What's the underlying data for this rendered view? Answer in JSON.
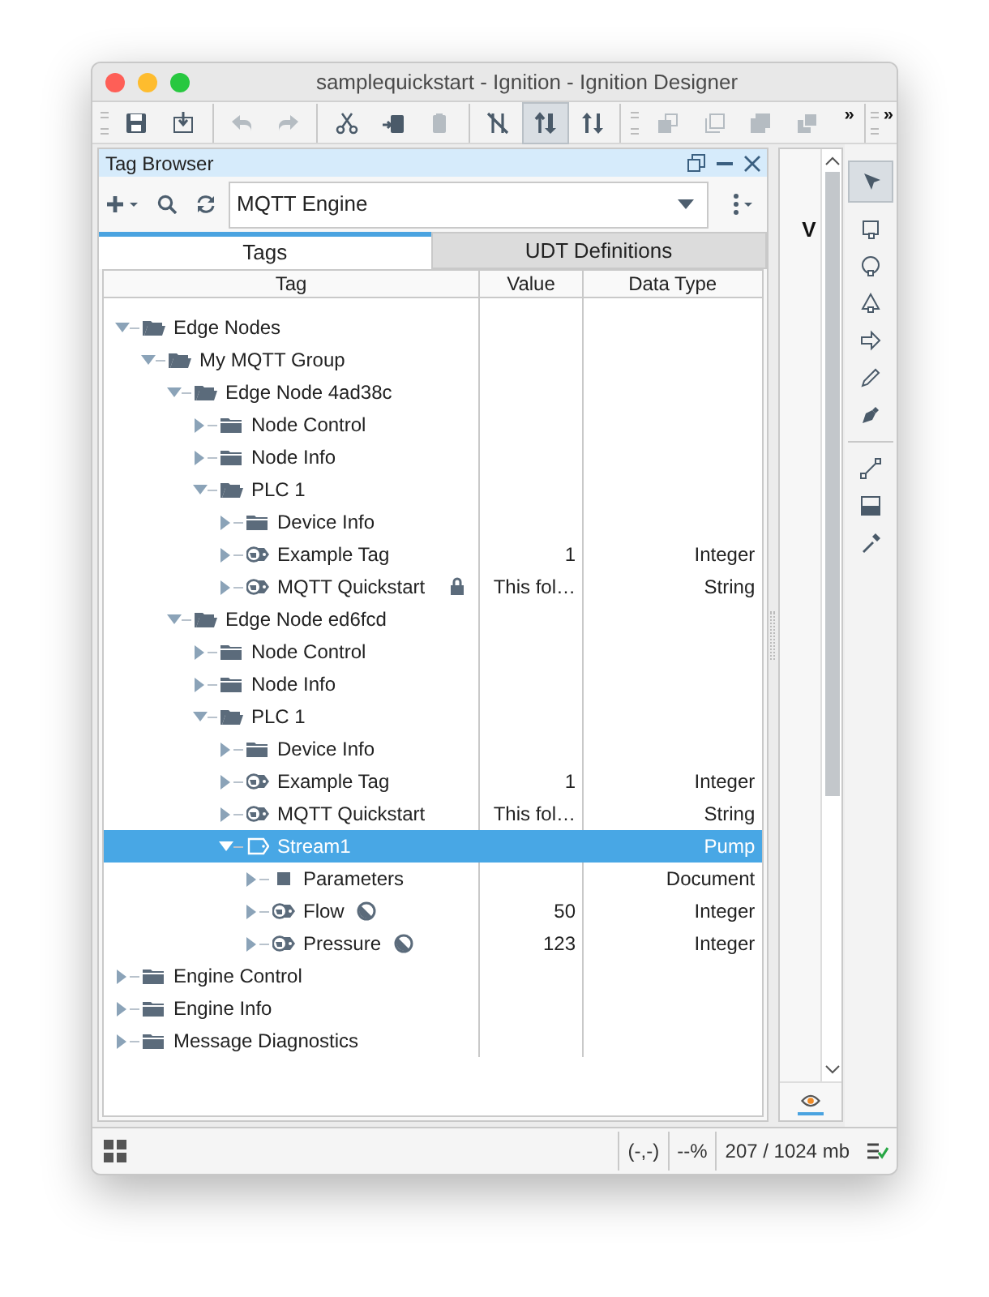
{
  "window": {
    "title": "samplequickstart - Ignition - Ignition Designer"
  },
  "toolbar": [
    {
      "kind": "save",
      "disabled": false,
      "selected": false
    },
    {
      "kind": "import",
      "disabled": false,
      "selected": false
    },
    {
      "kind": "sep"
    },
    {
      "kind": "undo",
      "disabled": true,
      "selected": false
    },
    {
      "kind": "redo",
      "disabled": true,
      "selected": false
    },
    {
      "kind": "sep"
    },
    {
      "kind": "cut",
      "disabled": false,
      "selected": false
    },
    {
      "kind": "paste-into",
      "disabled": false,
      "selected": false
    },
    {
      "kind": "paste",
      "disabled": true,
      "selected": false
    },
    {
      "kind": "sep"
    },
    {
      "kind": "no-bind",
      "disabled": false,
      "selected": false
    },
    {
      "kind": "bind-up",
      "disabled": false,
      "selected": true
    },
    {
      "kind": "bind-down",
      "disabled": false,
      "selected": false
    },
    {
      "kind": "grip"
    },
    {
      "kind": "layer-a",
      "disabled": true,
      "selected": false
    },
    {
      "kind": "layer-b",
      "disabled": true,
      "selected": false
    },
    {
      "kind": "layer-c",
      "disabled": true,
      "selected": false
    },
    {
      "kind": "layer-d",
      "disabled": true,
      "selected": false
    }
  ],
  "toolbar_overflow": [
    "»",
    "»"
  ],
  "panel": {
    "title": "Tag Browser",
    "provider": "MQTT Engine",
    "tabs": [
      {
        "label": "Tags",
        "selected": true
      },
      {
        "label": "UDT Definitions",
        "selected": false
      }
    ],
    "columns": [
      "Tag",
      "Value",
      "Data Type"
    ],
    "tree": [
      {
        "label": "Edge Nodes",
        "kind": "folder",
        "expanded": true,
        "selected": false,
        "children": [
          {
            "label": "My MQTT Group",
            "kind": "folder",
            "expanded": true,
            "selected": false,
            "children": [
              {
                "label": "Edge Node 4ad38c",
                "kind": "folder",
                "expanded": true,
                "selected": false,
                "children": [
                  {
                    "label": "Node Control",
                    "kind": "folder",
                    "expanded": false,
                    "selected": false
                  },
                  {
                    "label": "Node Info",
                    "kind": "folder",
                    "expanded": false,
                    "selected": false
                  },
                  {
                    "label": "PLC 1",
                    "kind": "folder",
                    "expanded": true,
                    "selected": false,
                    "children": [
                      {
                        "label": "Device Info",
                        "kind": "folder",
                        "expanded": false,
                        "selected": false
                      },
                      {
                        "label": "Example Tag",
                        "kind": "tag",
                        "expanded": false,
                        "selected": false,
                        "value": "1",
                        "data_type": "Integer"
                      },
                      {
                        "label": "MQTT Quickstart",
                        "kind": "lockedtag",
                        "expanded": false,
                        "selected": false,
                        "value": "This fol…",
                        "data_type": "String"
                      }
                    ]
                  }
                ]
              },
              {
                "label": "Edge Node ed6fcd",
                "kind": "folder",
                "expanded": true,
                "selected": false,
                "children": [
                  {
                    "label": "Node Control",
                    "kind": "folder",
                    "expanded": false,
                    "selected": false
                  },
                  {
                    "label": "Node Info",
                    "kind": "folder",
                    "expanded": false,
                    "selected": false
                  },
                  {
                    "label": "PLC 1",
                    "kind": "folder",
                    "expanded": true,
                    "selected": false,
                    "children": [
                      {
                        "label": "Device Info",
                        "kind": "folder",
                        "expanded": false,
                        "selected": false
                      },
                      {
                        "label": "Example Tag",
                        "kind": "tag",
                        "expanded": false,
                        "selected": false,
                        "value": "1",
                        "data_type": "Integer"
                      },
                      {
                        "label": "MQTT Quickstart",
                        "kind": "tag",
                        "expanded": false,
                        "selected": false,
                        "value": "This fol…",
                        "data_type": "String"
                      },
                      {
                        "label": "Stream1",
                        "kind": "udt",
                        "expanded": true,
                        "selected": true,
                        "data_type": "Pump",
                        "children": [
                          {
                            "label": "Parameters",
                            "kind": "document",
                            "expanded": false,
                            "selected": false,
                            "data_type": "Document"
                          },
                          {
                            "label": "Flow",
                            "kind": "overriddentag",
                            "expanded": false,
                            "selected": false,
                            "value": "50",
                            "data_type": "Integer"
                          },
                          {
                            "label": "Pressure",
                            "kind": "overriddentag",
                            "expanded": false,
                            "selected": false,
                            "value": "123",
                            "data_type": "Integer"
                          }
                        ]
                      }
                    ]
                  }
                ]
              }
            ]
          }
        ]
      },
      {
        "label": "Engine Control",
        "kind": "folder",
        "expanded": false,
        "selected": false
      },
      {
        "label": "Engine Info",
        "kind": "folder",
        "expanded": false,
        "selected": false
      },
      {
        "label": "Message Diagnostics",
        "kind": "folder",
        "expanded": false,
        "selected": false
      }
    ]
  },
  "canvas_text": "V",
  "status_bar": {
    "coords": "(-,-)",
    "zoom": "--%",
    "memory": "207 / 1024 mb"
  }
}
